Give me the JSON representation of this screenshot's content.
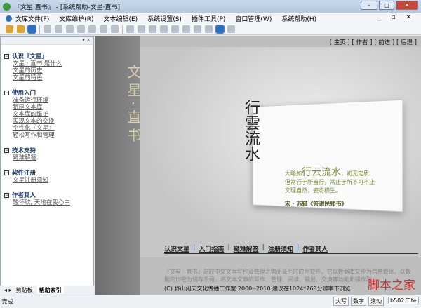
{
  "window": {
    "title": "『文星·直书』 - [系统帮助-文星·直书]"
  },
  "menu": [
    "文库文件(F)",
    "文库维护(R)",
    "文本编辑(E)",
    "系统设置(S)",
    "插件工具(P)",
    "窗口管理(W)",
    "系统帮助(H)"
  ],
  "left_panel": {
    "sections": [
      {
        "title": "认识『文星』",
        "links": [
          "文星 · 直书 是什么",
          "文星的历史",
          "文星的特色"
        ]
      },
      {
        "title": "使用入门",
        "links": [
          "准备运行环境",
          "新建文本库",
          "文本库的维护",
          "实现文本的交换",
          "个性化『文星』",
          "轻松写作和管理"
        ]
      },
      {
        "title": "技术支持",
        "links": [
          "疑难解答"
        ]
      },
      {
        "title": "软件注册",
        "links": [
          "文星注册须知"
        ]
      },
      {
        "title": "作者其人",
        "links": [
          "酸怀欣, 天地在我心中"
        ]
      }
    ],
    "tabs": [
      "剪贴板",
      "帮助索引"
    ]
  },
  "main": {
    "nav": [
      "[ 主页 ]",
      "[ 作者 ]",
      "[ 前进 ]",
      "[ 后退 ]"
    ],
    "cover_title": "文星·直书",
    "big_text": "行雲流水",
    "poem": {
      "line1_pre": "大略如",
      "line1_big": "行云流水",
      "line1_post": "，初无定质",
      "line2": "但常行于所当行，常止于所不可不止",
      "line3": "文理自然，姿态横生。",
      "source": "宋 · 苏轼《答谢民师书》"
    },
    "links": [
      "认识文星",
      "入门指南",
      "疑难解答",
      "注册须知",
      "作者其人"
    ],
    "intro": "『文星 · 直书』是应中文文本写作及管理之需而诞生的应用软件。它以数据库文件为信息载体，以数据的加密为储存手段，将文本文章的写作、管理、阅读、输出、交换等功能和操作融",
    "copyright": "(C) 野山闲天文化传播工作室 2000--2010  建议在1024*768分辨率下浏览",
    "watermark": "脚本之家"
  },
  "status": {
    "text": "完成",
    "indicators": [
      "大写",
      "数字",
      "滚动",
      "b502.Tite"
    ]
  }
}
